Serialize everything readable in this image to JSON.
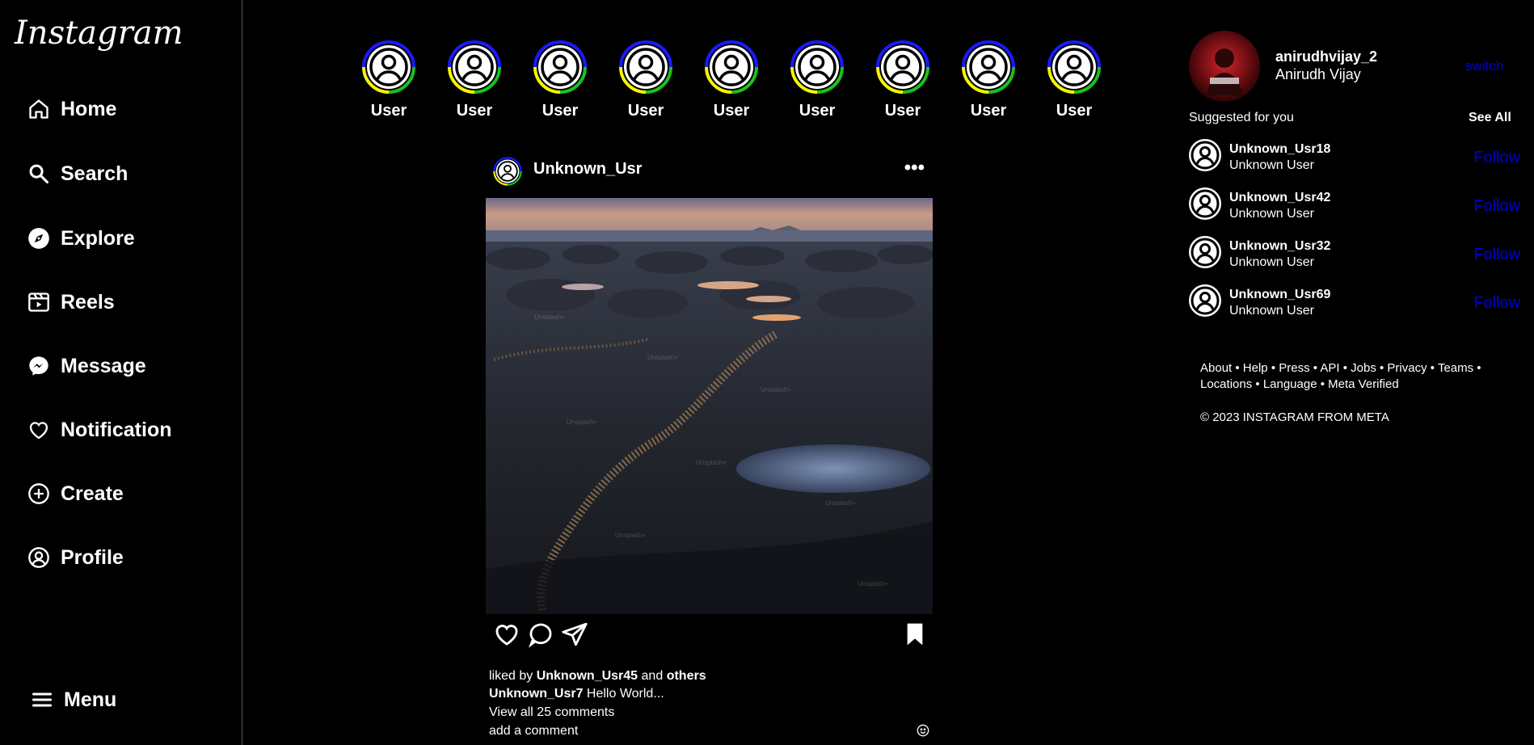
{
  "sidebar": {
    "logo": "Instagram",
    "items": [
      {
        "label": "Home",
        "icon": "home-icon"
      },
      {
        "label": "Search",
        "icon": "search-icon"
      },
      {
        "label": "Explore",
        "icon": "compass-icon"
      },
      {
        "label": "Reels",
        "icon": "reels-icon"
      },
      {
        "label": "Message",
        "icon": "messenger-icon"
      },
      {
        "label": "Notification",
        "icon": "heart-icon"
      },
      {
        "label": "Create",
        "icon": "plus-circle-icon"
      },
      {
        "label": "Profile",
        "icon": "user-circle-icon"
      }
    ],
    "menu_label": "Menu"
  },
  "stories": [
    {
      "label": "User"
    },
    {
      "label": "User"
    },
    {
      "label": "User"
    },
    {
      "label": "User"
    },
    {
      "label": "User"
    },
    {
      "label": "User"
    },
    {
      "label": "User"
    },
    {
      "label": "User"
    },
    {
      "label": "User"
    }
  ],
  "post": {
    "username": "Unknown_Usr",
    "more": "•••",
    "liked_by_prefix": "liked by",
    "liked_by_user": "Unknown_Usr45",
    "liked_by_and": "and",
    "liked_by_others": "others",
    "caption_user": "Unknown_Usr7",
    "caption_text": "Hello World...",
    "view_comments": "View all 25 comments",
    "add_comment": "add a comment",
    "watermark": "Unsplash+"
  },
  "account": {
    "username": "anirudhvijay_2",
    "name": "Anirudh Vijay",
    "switch_label": "switch"
  },
  "suggestions": {
    "title": "Suggested for you",
    "see_all": "See All",
    "items": [
      {
        "username": "Unknown_Usr18",
        "sub": "Unknown User",
        "action": "Follow"
      },
      {
        "username": "Unknown_Usr42",
        "sub": "Unknown User",
        "action": "Follow"
      },
      {
        "username": "Unknown_Usr32",
        "sub": "Unknown User",
        "action": "Follow"
      },
      {
        "username": "Unknown_Usr69",
        "sub": "Unknown User",
        "action": "Follow"
      }
    ]
  },
  "footer": {
    "links": [
      "About",
      "Help",
      "Press",
      "API",
      "Jobs",
      "Privacy",
      "Teams",
      "Locations",
      "Language",
      "Meta Verified"
    ],
    "copyright": "© 2023 INSTAGRAM FROM META"
  },
  "colors": {
    "background": "#000000",
    "link_blue": "#0000d8",
    "story_ring_top": "#1a1aff",
    "story_ring_right": "#19c21e",
    "story_ring_bottom": "#f5f500"
  }
}
